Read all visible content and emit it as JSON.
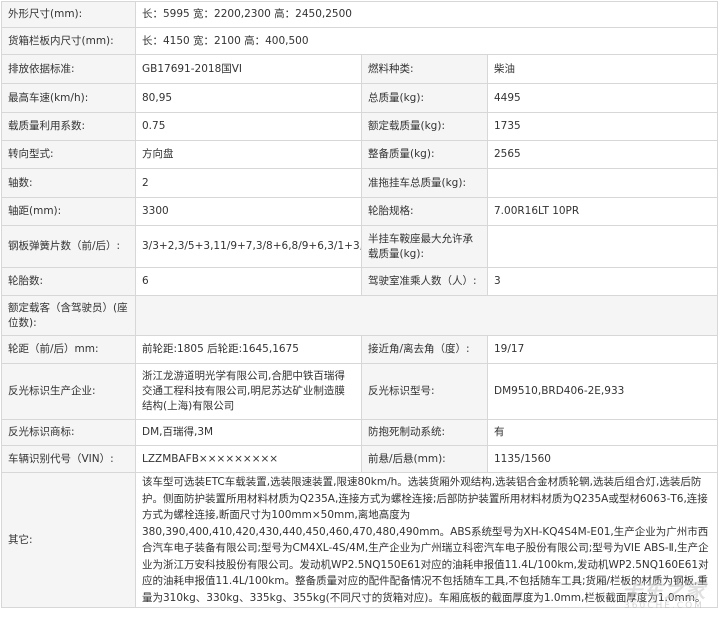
{
  "specs": {
    "outer_dims": {
      "label": "外形尺寸(mm):",
      "value": "长：5995 宽：2200,2300 高：2450,2500"
    },
    "cargo_dims": {
      "label": "货箱栏板内尺寸(mm):",
      "value": "长：4150 宽：2100 高：400,500"
    },
    "emission": {
      "label": "排放依据标准:",
      "value": "GB17691-2018国VI"
    },
    "fuel": {
      "label": "燃料种类:",
      "value": "柴油"
    },
    "max_speed": {
      "label": "最高车速(km/h):",
      "value": "80,95"
    },
    "total_mass": {
      "label": "总质量(kg):",
      "value": "4495"
    },
    "load_util": {
      "label": "载质量利用系数:",
      "value": "0.75"
    },
    "rated_load": {
      "label": "额定载质量(kg):",
      "value": "1735"
    },
    "steering": {
      "label": "转向型式:",
      "value": "方向盘"
    },
    "curb_mass": {
      "label": "整备质量(kg):",
      "value": "2565"
    },
    "axles": {
      "label": "轴数:",
      "value": "2"
    },
    "trailer_mass": {
      "label": "准拖挂车总质量(kg):",
      "value": ""
    },
    "wheelbase": {
      "label": "轴距(mm):",
      "value": "3300"
    },
    "tire_spec": {
      "label": "轮胎规格:",
      "value": "7.00R16LT 10PR"
    },
    "leaf_springs": {
      "label": "钢板弹簧片数（前/后）:",
      "value": "3/3+2,3/5+3,11/9+7,3/8+6,8/9+6,3/1+3,3/5+1,8/9+8"
    },
    "saddle_load": {
      "label": "半挂车鞍座最大允许承载质量(kg):",
      "value": ""
    },
    "tire_count": {
      "label": "轮胎数:",
      "value": "6"
    },
    "cab_seats": {
      "label": "驾驶室准乘人数（人）:",
      "value": "3"
    },
    "rated_passengers": {
      "label": "额定载客（含驾驶员）(座位数):",
      "value": ""
    },
    "track": {
      "label": "轮距（前/后）mm:",
      "value": "前轮距:1805 后轮距:1645,1675"
    },
    "angles": {
      "label": "接近角/离去角（度）:",
      "value": "19/17"
    },
    "reflector_maker": {
      "label": "反光标识生产企业:",
      "value": "浙江龙游道明光学有限公司,合肥中铁百瑞得交通工程科技有限公司,明尼苏达矿业制造膜结构(上海)有限公司"
    },
    "reflector_model": {
      "label": "反光标识型号:",
      "value": "DM9510,BRD406-2E,933"
    },
    "reflector_brand": {
      "label": "反光标识商标:",
      "value": "DM,百瑞得,3M"
    },
    "abs": {
      "label": "防抱死制动系统:",
      "value": "有"
    },
    "vin": {
      "label": "车辆识别代号（VIN）:",
      "value": "LZZMBAFB×××××××××"
    },
    "overhang": {
      "label": "前悬/后悬(mm):",
      "value": "1135/1560"
    },
    "notes": {
      "label": "其它:",
      "value": "该车型可选装ETC车载装置,选装限速装置,限速80km/h。选装货厢外观结构,选装铝合金材质轮辋,选装后组合灯,选装后防护。侧面防护装置所用材料材质为Q235A,连接方式为螺栓连接;后部防护装置所用材料材质为Q235A或型材6063-T6,连接方式为螺栓连接,断面尺寸为100mm×50mm,离地高度为380,390,400,410,420,430,440,450,460,470,480,490mm。ABS系统型号为XH-KQ4S4M-E01,生产企业为广州市西合汽车电子装备有限公司;型号为CM4XL-4S/4M,生产企业为广州瑞立科密汽车电子股份有限公司;型号为VIE ABS-Ⅱ,生产企业为浙江万安科技股份有限公司。发动机WP2.5NQ150E61对应的油耗申报值11.4L/100km,发动机WP2.5NQ160E61对应的油耗申报值11.4L/100km。整备质量对应的配件配备情况不包括随车工具,不包括随车工具;货厢/栏板的材质为钢板,重量为310kg、330kg、335kg、355kg(不同尺寸的货箱对应)。车厢底板的截面厚度为1.0mm,栏板截面厚度为1.0mm。"
    }
  },
  "watermark": {
    "main": "卡车之家",
    "sub": "360CHE.COM"
  }
}
